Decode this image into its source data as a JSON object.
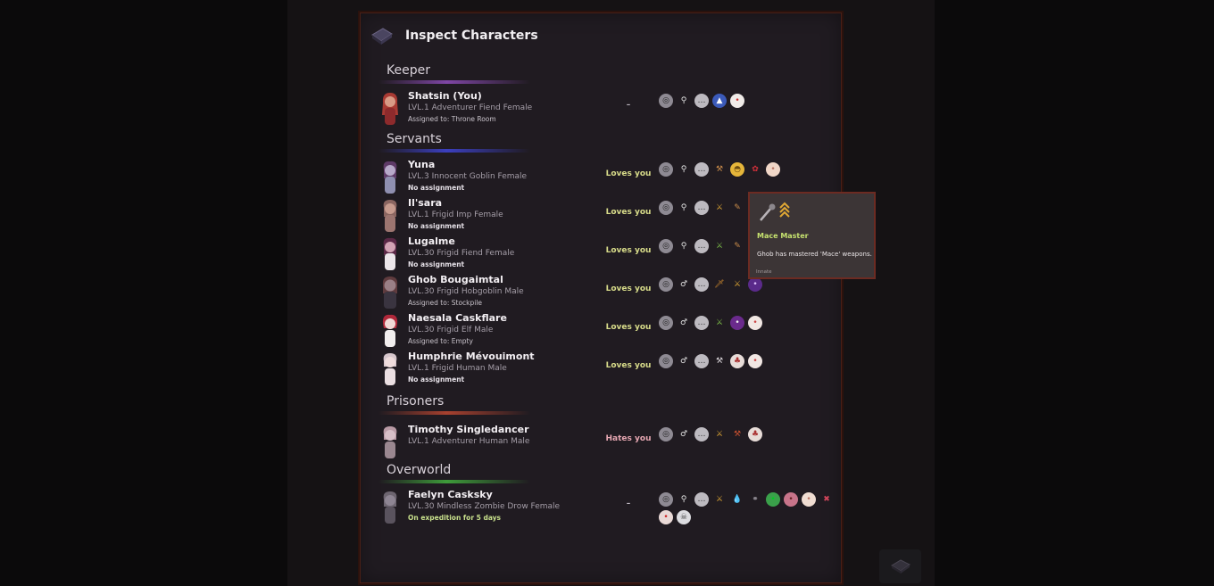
{
  "window": {
    "title": "Inspect Characters"
  },
  "sections": [
    {
      "title": "Keeper",
      "line_color": "#7f46a5",
      "characters": [
        {
          "name": "Shatsin (You)",
          "meta": "LVL.1 Adventurer Fiend Female",
          "assignment": "Assigned to: Throne Room",
          "relation": "–",
          "traits": [
            "mask-icon",
            "pin-icon",
            "speech-icon",
            "blue-hat-icon",
            "egg-face-icon"
          ]
        }
      ]
    },
    {
      "title": "Servants",
      "line_color": "#3b3fbf",
      "characters": [
        {
          "name": "Yuna",
          "meta": "LVL.3 Innocent Goblin Female",
          "assignment": "No assignment",
          "relation": "Loves you",
          "traits": [
            "mask-icon",
            "pin-icon",
            "speech-icon",
            "pickaxe-icon",
            "helmet-icon",
            "rose-icon",
            "face-icon"
          ]
        },
        {
          "name": "Il'sara",
          "meta": "LVL.1 Frigid Imp Female",
          "assignment": "No assignment",
          "relation": "Loves you",
          "traits": [
            "mask-icon",
            "pin-icon",
            "speech-icon",
            "mace-icon",
            "wrench-icon"
          ]
        },
        {
          "name": "Lugalme",
          "meta": "LVL.30 Frigid Fiend Female",
          "assignment": "No assignment",
          "relation": "Loves you",
          "traits": [
            "mask-icon",
            "pin-icon",
            "speech-icon",
            "mace-icon",
            "wrench-icon"
          ]
        },
        {
          "name": "Ghob Bougaimtal",
          "meta": "LVL.30 Frigid Hobgoblin Male",
          "assignment": "Assigned to: Stockpile",
          "relation": "Loves you",
          "traits": [
            "mask-icon",
            "male-icon",
            "speech-icon",
            "dagger-icon",
            "mace-icon",
            "demon-face-icon"
          ]
        },
        {
          "name": "Naesala Caskflare",
          "meta": "LVL.30 Frigid Elf Male",
          "assignment": "Assigned to: Empty",
          "relation": "Loves you",
          "traits": [
            "mask-icon",
            "male-icon",
            "speech-icon",
            "sword-icon",
            "purple-face-icon",
            "face-icon"
          ]
        },
        {
          "name": "Humphrie Mévouimont",
          "meta": "LVL.1 Frigid Human Male",
          "assignment": "No assignment",
          "relation": "Loves you",
          "traits": [
            "mask-icon",
            "male-icon",
            "speech-icon",
            "axe-icon",
            "mushroom-icon",
            "face-icon"
          ]
        }
      ]
    },
    {
      "title": "Prisoners",
      "line_color": "#a7412f",
      "characters": [
        {
          "name": "Timothy Singledancer",
          "meta": "LVL.1 Adventurer Human Male",
          "assignment": "",
          "relation": "Hates you",
          "traits": [
            "mask-icon",
            "male-icon",
            "speech-icon",
            "sword-icon",
            "pickaxe-icon",
            "mushroom-icon"
          ]
        }
      ]
    },
    {
      "title": "Overworld",
      "line_color": "#3e9b3a",
      "characters": [
        {
          "name": "Faelyn Casksky",
          "meta": "LVL.30 Mindless Zombie Drow Female",
          "assignment": "On expedition for 5 days",
          "relation": "–",
          "traits": [
            "mask-icon",
            "pin-icon",
            "speech-icon",
            "sword-icon",
            "drop-icon",
            "chain-icon",
            "green-face-icon",
            "pig-icon",
            "face-icon",
            "cross-icon",
            "red-face-icon",
            "skull-icon"
          ]
        }
      ]
    }
  ],
  "tooltip": {
    "title": "Mace Master",
    "description": "Ghob  has mastered 'Mace' weapons.",
    "footer": "Innate"
  },
  "colors": {
    "panel_bg": "#201b21",
    "panel_border": "#4a1f16",
    "loves": "#d8dc8a",
    "hates": "#e6a7b2",
    "tooltip_title": "#c6e26f"
  }
}
